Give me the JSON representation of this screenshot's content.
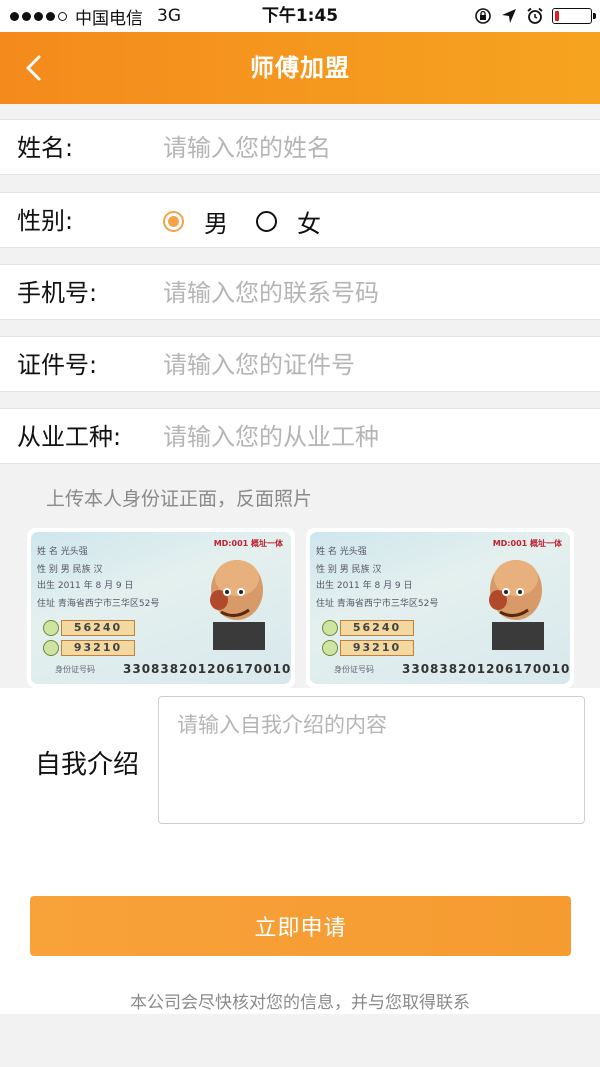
{
  "status_bar": {
    "carrier": "中国电信",
    "network": "3G",
    "time": "下午1:45"
  },
  "nav": {
    "title": "师傅加盟"
  },
  "form": {
    "name": {
      "label": "姓名:",
      "placeholder": "请输入您的姓名"
    },
    "gender": {
      "label": "性别:",
      "options": [
        "男",
        "女"
      ],
      "selected": "男"
    },
    "phone": {
      "label": "手机号:",
      "placeholder": "请输入您的联系号码"
    },
    "id_number": {
      "label": "证件号:",
      "placeholder": "请输入您的证件号"
    },
    "occupation": {
      "label": "从业工种:",
      "placeholder": "请输入您的从业工种"
    }
  },
  "upload": {
    "title": "上传本人身份证正面，反面照片",
    "cards": [
      {
        "name_line": "姓 名  光头强",
        "sex_line": "性 别  男    民族 汉",
        "birth_line": "出生  2011 年 8 月 9 日",
        "addr_line": "住址  青海省西宁市三华区52号",
        "stamp": "MD:001 概址一体",
        "num1": "56240",
        "num2": "93210",
        "id_label": "身份证号码",
        "id_number": "330838201206170010"
      },
      {
        "name_line": "姓 名  光头强",
        "sex_line": "性 别  男    民族 汉",
        "birth_line": "出生  2011 年 8 月 9 日",
        "addr_line": "住址  青海省西宁市三华区52号",
        "stamp": "MD:001 概址一体",
        "num1": "56240",
        "num2": "93210",
        "id_label": "身份证号码",
        "id_number": "330838201206170010"
      }
    ]
  },
  "intro": {
    "label": "自我介绍",
    "placeholder": "请输入自我介绍的内容"
  },
  "submit": {
    "label": "立即申请",
    "note": "本公司会尽快核对您的信息，并与您取得联系"
  },
  "battery_level": 0.12,
  "colors": {
    "accent": "#f59b30",
    "nav_gradient_start": "#f48a1c",
    "nav_gradient_end": "#f6a420",
    "radio_checked": "#f5a24a",
    "placeholder": "#b5b5b5"
  }
}
